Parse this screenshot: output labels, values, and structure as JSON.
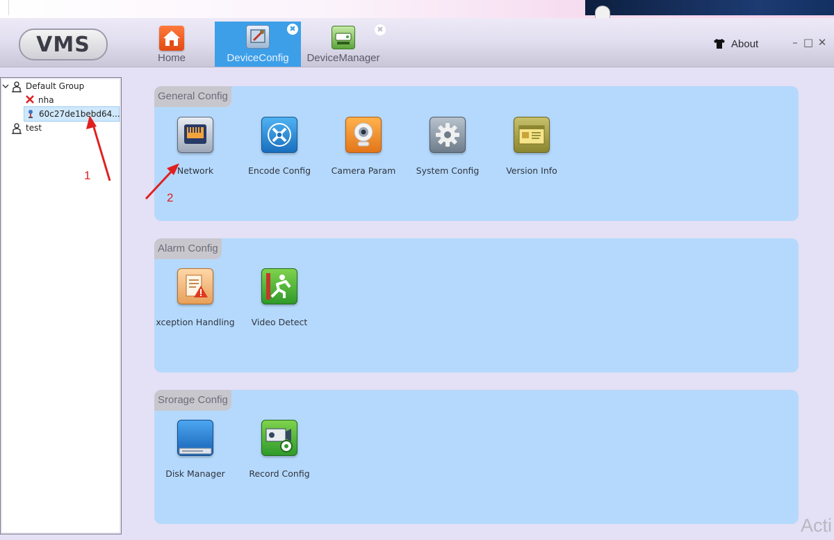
{
  "app": {
    "logo": "VMS",
    "tabs": [
      {
        "label": "Home",
        "icon": "home-icon",
        "active": false
      },
      {
        "label": "DeviceConfig",
        "icon": "device-config-icon",
        "active": true
      },
      {
        "label": "DeviceManager",
        "icon": "device-manager-icon",
        "active": false
      }
    ],
    "about_label": "About",
    "window_controls": {
      "minimize": "–",
      "maximize": "□",
      "close": "✕"
    },
    "tab_close_glyph": "✖"
  },
  "tree": {
    "items": [
      {
        "label": "Default Group",
        "icon": "group-user-icon",
        "expanded": true
      },
      {
        "label": "nha",
        "icon": "offline-device-icon",
        "status": "offline"
      },
      {
        "label": "60c27de1bebd64...",
        "icon": "online-device-icon",
        "status": "online",
        "selected": true
      },
      {
        "label": "test",
        "icon": "group-user-icon"
      }
    ]
  },
  "sections": [
    {
      "title": "General Config",
      "items": [
        {
          "label": "Network",
          "icon": "network-port-icon"
        },
        {
          "label": "Encode Config",
          "icon": "encode-tools-icon"
        },
        {
          "label": "Camera Param",
          "icon": "webcam-icon"
        },
        {
          "label": "System Config",
          "icon": "gear-icon"
        },
        {
          "label": "Version Info",
          "icon": "version-info-icon"
        }
      ]
    },
    {
      "title": "Alarm Config",
      "items": [
        {
          "label": "xception Handling",
          "icon": "exception-warning-icon"
        },
        {
          "label": "Video Detect",
          "icon": "motion-detect-icon"
        }
      ]
    },
    {
      "title": "Srorage Config",
      "items": [
        {
          "label": "Disk Manager",
          "icon": "disk-icon"
        },
        {
          "label": "Record Config",
          "icon": "record-config-icon"
        }
      ]
    }
  ],
  "annotations": {
    "step1": "1",
    "step2": "2"
  },
  "watermark": "Acti",
  "colors": {
    "active_tab": "#3d9fe8",
    "section_bg": "#b5d9fc",
    "annotation": "#e02020"
  }
}
